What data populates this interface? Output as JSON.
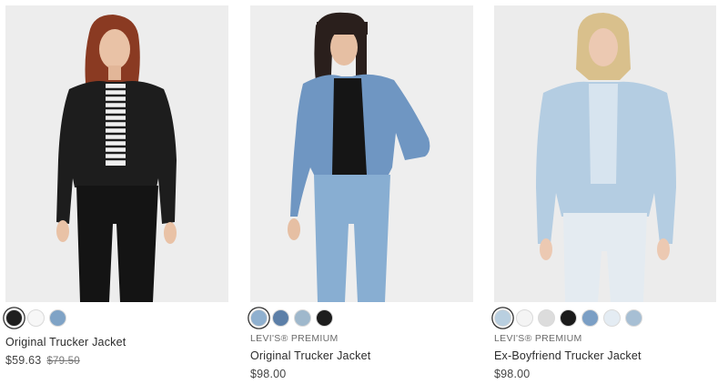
{
  "products": [
    {
      "brand": "",
      "name": "Original Trucker Jacket",
      "price": "$59.63",
      "original_price": "$79.50",
      "swatches": [
        "#1f1f1f",
        "#f7f7f7",
        "#7fa3c6"
      ],
      "selected_swatch": 0
    },
    {
      "brand": "LEVI'S® PREMIUM",
      "name": "Original Trucker Jacket",
      "price": "$98.00",
      "original_price": "",
      "swatches": [
        "#8fb0cf",
        "#5c7fa8",
        "#9fb8cc",
        "#1d1d1d"
      ],
      "selected_swatch": 0
    },
    {
      "brand": "LEVI'S® PREMIUM",
      "name": "Ex-Boyfriend Trucker Jacket",
      "price": "$98.00",
      "original_price": "",
      "swatches": [
        "#b9cfe0",
        "#f4f4f4",
        "#dcdcdc",
        "#1b1b1b",
        "#7b9fc5",
        "#e4ecf3",
        "#a7bfd4"
      ],
      "selected_swatch": 0
    }
  ]
}
